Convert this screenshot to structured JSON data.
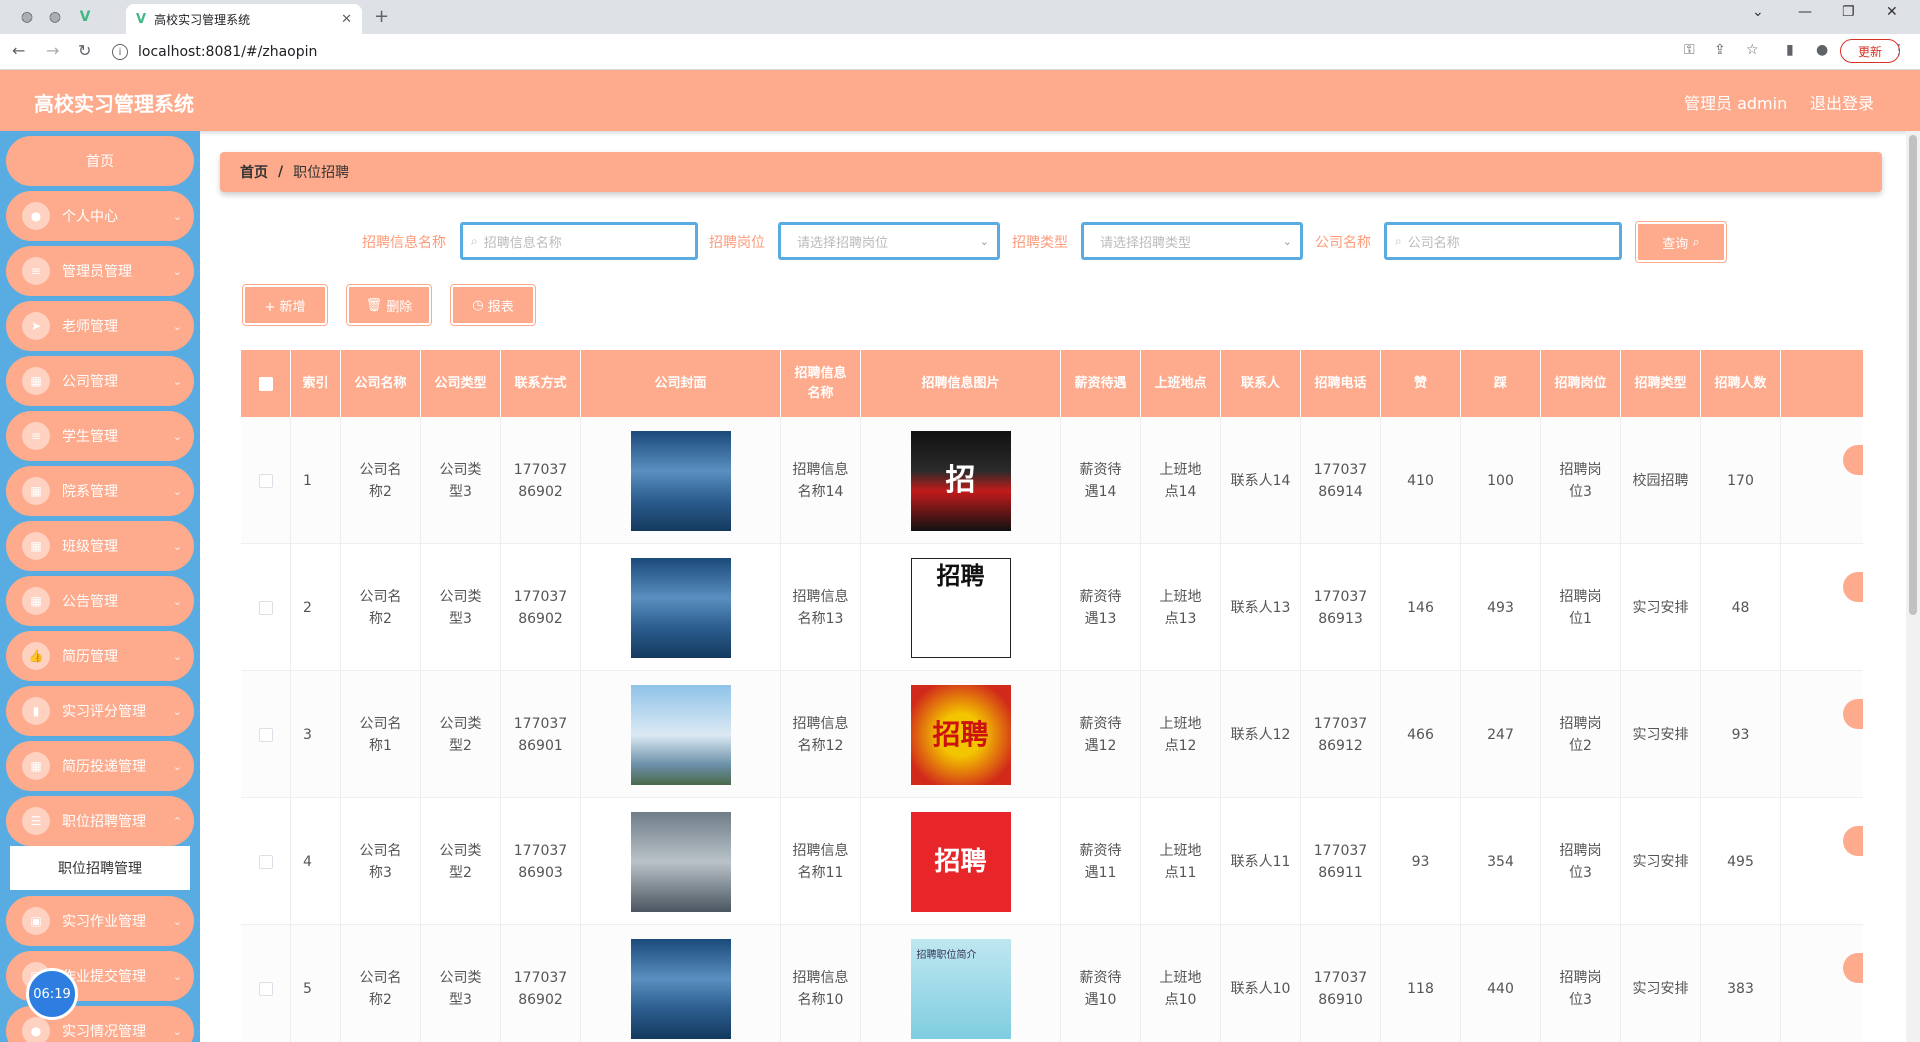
{
  "browser": {
    "tab_title": "高校实习管理系统",
    "url": "localhost:8081/#/zhaopin",
    "update_label": "更新"
  },
  "header": {
    "title": "高校实习管理系统",
    "user": "管理员 admin",
    "logout": "退出登录"
  },
  "sidebar": {
    "home": "首页",
    "items": [
      {
        "label": "个人中心",
        "icon": "user-icon"
      },
      {
        "label": "管理员管理",
        "icon": "list-icon"
      },
      {
        "label": "老师管理",
        "icon": "send-icon"
      },
      {
        "label": "公司管理",
        "icon": "grid-icon"
      },
      {
        "label": "学生管理",
        "icon": "list-icon"
      },
      {
        "label": "院系管理",
        "icon": "grid-icon"
      },
      {
        "label": "班级管理",
        "icon": "grid-icon"
      },
      {
        "label": "公告管理",
        "icon": "grid-icon"
      },
      {
        "label": "简历管理",
        "icon": "thumb-icon"
      },
      {
        "label": "实习评分管理",
        "icon": "chart-icon"
      },
      {
        "label": "简历投递管理",
        "icon": "grid-icon"
      },
      {
        "label": "职位招聘管理",
        "icon": "sliders-icon"
      },
      {
        "label": "实习作业管理",
        "icon": "ticket-icon"
      },
      {
        "label": "作业提交管理",
        "icon": "doc-icon"
      },
      {
        "label": "实习情况管理",
        "icon": "user-icon"
      }
    ],
    "submenu_active": "职位招聘管理",
    "clock": "06:19"
  },
  "breadcrumb": {
    "home": "首页",
    "sep": "/",
    "current": "职位招聘"
  },
  "filters": {
    "name_label": "招聘信息名称",
    "name_placeholder": "招聘信息名称",
    "post_label": "招聘岗位",
    "post_placeholder": "请选择招聘岗位",
    "type_label": "招聘类型",
    "type_placeholder": "请选择招聘类型",
    "company_label": "公司名称",
    "company_placeholder": "公司名称",
    "search_button": "查询"
  },
  "actions": {
    "add": "+ 新增",
    "delete": "删除",
    "report": "报表"
  },
  "table": {
    "headers": [
      "索引",
      "公司名称",
      "公司类型",
      "联系方式",
      "公司封面",
      "招聘信息名称",
      "招聘信息图片",
      "薪资待遇",
      "上班地点",
      "联系人",
      "招聘电话",
      "赞",
      "踩",
      "招聘岗位",
      "招聘类型",
      "招聘人数"
    ],
    "rows": [
      {
        "idx": "1",
        "company": "公司名称2",
        "ctype": "公司类型3",
        "contact": "17703786902",
        "name": "招聘信息名称14",
        "salary": "薪资待遇14",
        "place": "上班地点14",
        "person": "联系人14",
        "phone": "17703786914",
        "up": "410",
        "down": "100",
        "post": "招聘岗位3",
        "type": "校园招聘",
        "count": "170"
      },
      {
        "idx": "2",
        "company": "公司名称2",
        "ctype": "公司类型3",
        "contact": "17703786902",
        "name": "招聘信息名称13",
        "salary": "薪资待遇13",
        "place": "上班地点13",
        "person": "联系人13",
        "phone": "17703786913",
        "up": "146",
        "down": "493",
        "post": "招聘岗位1",
        "type": "实习安排",
        "count": "48"
      },
      {
        "idx": "3",
        "company": "公司名称1",
        "ctype": "公司类型2",
        "contact": "17703786901",
        "name": "招聘信息名称12",
        "salary": "薪资待遇12",
        "place": "上班地点12",
        "person": "联系人12",
        "phone": "17703786912",
        "up": "466",
        "down": "247",
        "post": "招聘岗位2",
        "type": "实习安排",
        "count": "93"
      },
      {
        "idx": "4",
        "company": "公司名称3",
        "ctype": "公司类型2",
        "contact": "17703786903",
        "name": "招聘信息名称11",
        "salary": "薪资待遇11",
        "place": "上班地点11",
        "person": "联系人11",
        "phone": "17703786911",
        "up": "93",
        "down": "354",
        "post": "招聘岗位3",
        "type": "实习安排",
        "count": "495"
      },
      {
        "idx": "5",
        "company": "公司名称2",
        "ctype": "公司类型3",
        "contact": "17703786902",
        "name": "招聘信息名称10",
        "salary": "薪资待遇10",
        "place": "上班地点10",
        "person": "联系人10",
        "phone": "17703786910",
        "up": "118",
        "down": "440",
        "post": "招聘岗位3",
        "type": "实习安排",
        "count": "383"
      }
    ],
    "image_text": {
      "r1": "招",
      "r2": "招聘",
      "r3": "招聘",
      "r4": "招聘",
      "r5": "招聘职位简介"
    }
  }
}
